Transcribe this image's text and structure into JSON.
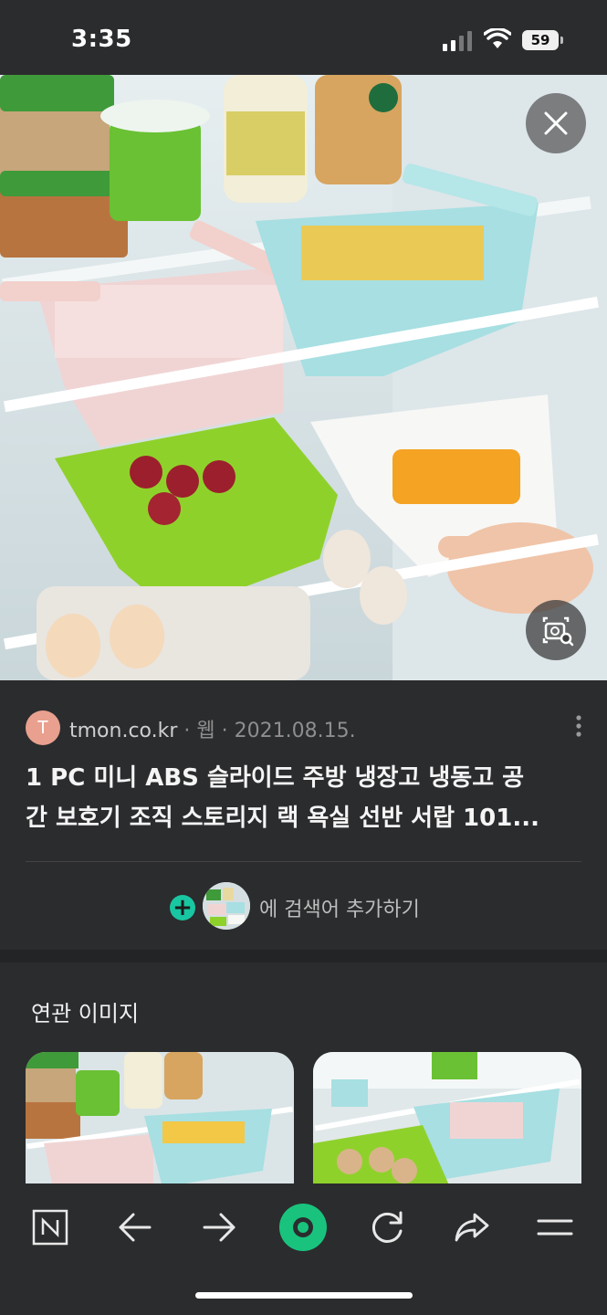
{
  "status_bar": {
    "time": "3:35",
    "battery": "59"
  },
  "image_viewer": {
    "close_icon": "close-icon",
    "lens_icon": "image-search-icon"
  },
  "result": {
    "avatar_letter": "T",
    "source": "tmon.co.kr",
    "separator1": " · ",
    "type": "웹",
    "separator2": " · ",
    "date": "2021.08.15.",
    "title_line1": "1 PC 미니 ABS 슬라이드 주방 냉장고 냉동고 공",
    "title_line2": "간 보호기 조직 스토리지 랙 욕실 선반 서랍 101..."
  },
  "add_search": {
    "plus": "+",
    "label": "에 검색어 추가하기"
  },
  "related": {
    "title": "연관 이미지"
  },
  "colors": {
    "background": "#2b2c2e",
    "accent": "#19c6a2",
    "avatar": "#e9a08f"
  },
  "bottom_nav": {
    "items": [
      "naver-home-icon",
      "back-arrow-icon",
      "forward-arrow-icon",
      "green-dot-icon",
      "refresh-icon",
      "share-icon",
      "menu-icon"
    ]
  }
}
